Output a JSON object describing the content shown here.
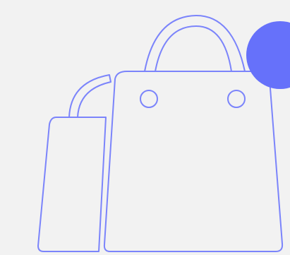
{
  "illustration": {
    "icon": "shopping-bags-icon",
    "stroke_color": "#7b84fb",
    "background_color": "#f2f2f2"
  },
  "badge": {
    "icon": "notification-dot",
    "color": "#6671fa"
  }
}
